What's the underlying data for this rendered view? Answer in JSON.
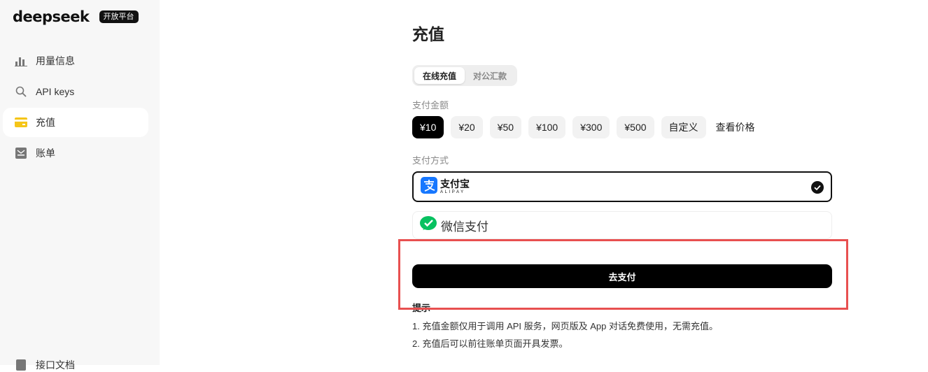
{
  "brand": {
    "name": "deepseek",
    "badge": "开放平台"
  },
  "sidebar": {
    "items": [
      {
        "label": "用量信息",
        "icon": "bar-chart-icon"
      },
      {
        "label": "API keys",
        "icon": "search-icon"
      },
      {
        "label": "充值",
        "icon": "wallet-icon",
        "active": true
      },
      {
        "label": "账单",
        "icon": "bill-icon"
      }
    ],
    "bottom_item": {
      "label": "接口文档",
      "icon": "doc-icon"
    }
  },
  "page": {
    "title": "充值",
    "tabs": [
      {
        "label": "在线充值",
        "active": true
      },
      {
        "label": "对公汇款",
        "active": false
      }
    ],
    "amount_label": "支付金额",
    "amounts": [
      {
        "label": "¥10",
        "active": true
      },
      {
        "label": "¥20"
      },
      {
        "label": "¥50"
      },
      {
        "label": "¥100"
      },
      {
        "label": "¥300"
      },
      {
        "label": "¥500"
      },
      {
        "label": "自定义"
      }
    ],
    "view_price_link": "查看价格",
    "method_label": "支付方式",
    "methods": {
      "alipay": {
        "cn": "支付宝",
        "en": "ALIPAY",
        "selected": true
      },
      "wechat": {
        "label": "微信支付",
        "selected": false
      }
    },
    "pay_button": "去支付",
    "tips_title": "提示",
    "tips": [
      "1. 充值金额仅用于调用 API 服务，网页版及 App 对话免费使用，无需充值。",
      "2. 充值后可以前往账单页面开具发票。"
    ]
  },
  "colors": {
    "accent": "#000000",
    "highlight_border": "#e85050",
    "alipay_blue": "#1677ff",
    "wechat_green": "#07c160",
    "wallet_yellow": "#f5c518"
  }
}
